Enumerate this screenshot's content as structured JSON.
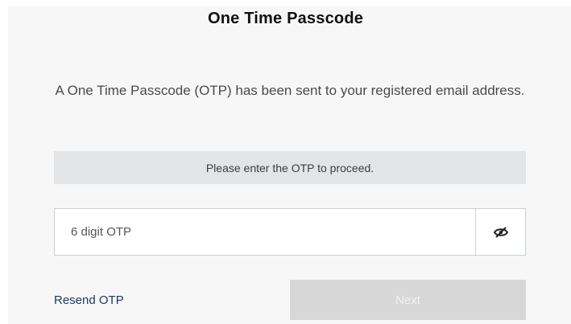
{
  "dialog": {
    "title": "One Time Passcode",
    "description": "A One Time Passcode (OTP) has been sent to your registered email address.",
    "notice": "Please enter the OTP to proceed."
  },
  "otp_input": {
    "placeholder": "6 digit OTP",
    "value": "",
    "toggle_icon": "eye-slash-icon"
  },
  "actions": {
    "resend_label": "Resend OTP",
    "next_label": "Next"
  },
  "colors": {
    "card_background": "#f7f7f8",
    "notice_background": "#e2e4e6",
    "link_color": "#1f3864",
    "next_disabled_background": "#d7d7d7"
  }
}
